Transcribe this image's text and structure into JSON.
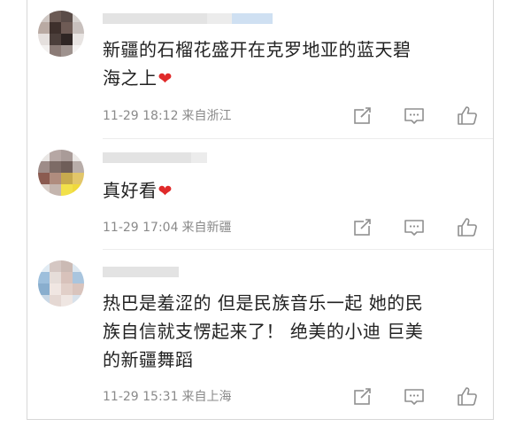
{
  "comments": [
    {
      "text_line1": "新疆的石榴花盛开在克罗地亚的蓝天碧",
      "text_line2": "海之上",
      "emoji": "❤",
      "time": "11-29 18:12",
      "location": "来自浙江"
    },
    {
      "text_line1": "真好看",
      "emoji": "❤",
      "time": "11-29 17:04",
      "location": "来自新疆"
    },
    {
      "text_line1": "热巴是羞涩的 但是民族音乐一起 她的民",
      "text_line2": "族自信就支愣起来了！ 绝美的小迪 巨美",
      "text_line3": "的新疆舞蹈",
      "time": "11-29 15:31",
      "location": "来自上海"
    }
  ],
  "icons": {
    "share": "share-icon",
    "comment": "comment-icon",
    "like": "like-icon"
  },
  "colors": {
    "text": "#222222",
    "meta": "#8a8a8a",
    "icon": "#8f8f8f",
    "heart": "#e02a2a",
    "username_blur": "#e3e3e3",
    "username_blur_blue": "#cfe0f2"
  }
}
